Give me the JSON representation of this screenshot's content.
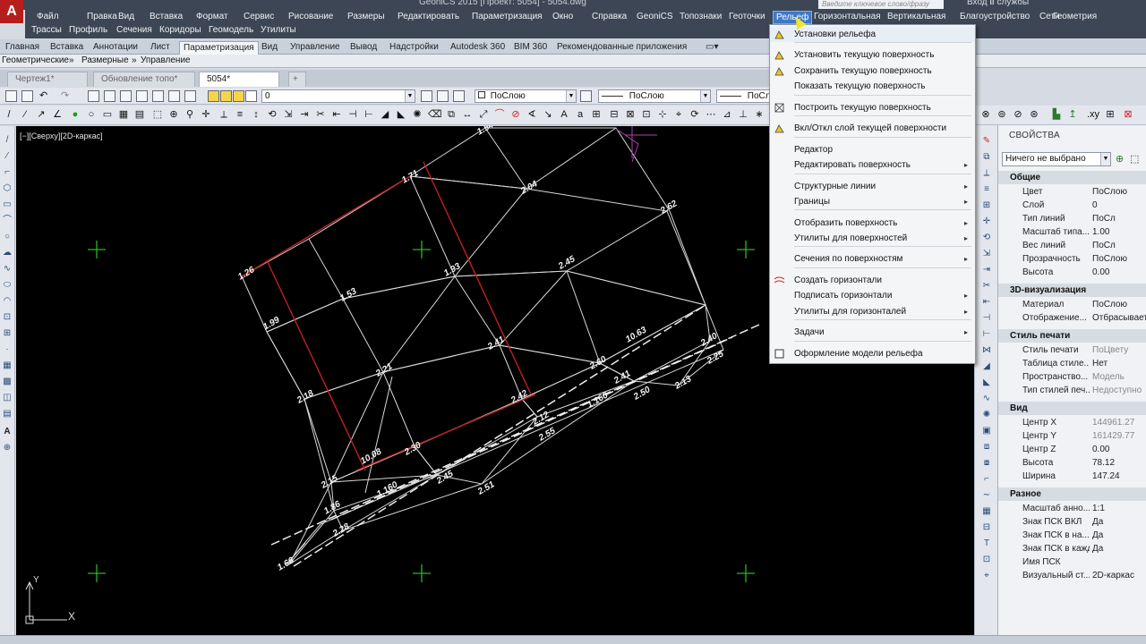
{
  "titlebar": {
    "title": "GeoniCS 2015 [Проект: 5054] - 5054.dwg",
    "search_placeholder": "Введите ключевое слово/фразу",
    "login": "Вход в службы"
  },
  "app_button": {
    "label": "A"
  },
  "menu": [
    "Файл",
    "Правка",
    "Вид",
    "Вставка",
    "Формат",
    "Сервис",
    "Рисование",
    "Размеры",
    "Редактировать",
    "Параметризация",
    "Окно",
    "Справка",
    "GeoniCS",
    "Топознаки",
    "Геоточки",
    "Рельеф",
    "Горизонтальная",
    "Вертикальная",
    "Благоустройство",
    "Сети",
    "Геометрия"
  ],
  "menu_active": "Рельеф",
  "menu2": [
    "Трассы",
    "Профиль",
    "Сечения",
    "Коридоры",
    "Геомодель",
    "Утилиты"
  ],
  "ribbon_tabs": [
    "Главная",
    "Вставка",
    "Аннотации",
    "Лист",
    "Параметризация",
    "Вид",
    "Управление",
    "Вывод",
    "Надстройки",
    "Autodesk 360",
    "BIM 360",
    "Рекомендованные приложения"
  ],
  "ribbon_active": "Параметризация",
  "ribbon_panels": [
    "Геометрические",
    "Размерные",
    "Управление"
  ],
  "doc_tabs": [
    {
      "label": "Чертеж1*",
      "active": false
    },
    {
      "label": "Обновление топо*",
      "active": false
    },
    {
      "label": "5054*",
      "active": true
    }
  ],
  "layer_combo": "0",
  "color_combo": "ПоСлою",
  "linetype_combo": "ПоСлою",
  "lineweight_combo": "ПоСло",
  "viewport_label": "[−][Сверху][2D-каркас]",
  "context_menu": {
    "items": [
      {
        "label": "Установки рельефа",
        "sub": false,
        "hi": true
      },
      {
        "label": "Установить текущую поверхность",
        "sub": false
      },
      {
        "label": "Сохранить текущую поверхность",
        "sub": false
      },
      {
        "label": "Показать текущую поверхность",
        "sub": false
      },
      {
        "label": "Построить текущую поверхность",
        "sub": false
      },
      {
        "label": "Вкл/Откл слой текущей поверхности",
        "sub": false
      },
      {
        "label": "Редактор",
        "sub": false
      },
      {
        "label": "Редактировать поверхность",
        "sub": true
      },
      {
        "label": "Структурные линии",
        "sub": true
      },
      {
        "label": "Границы",
        "sub": true
      },
      {
        "label": "Отобразить поверхность",
        "sub": true
      },
      {
        "label": "Утилиты для поверхностей",
        "sub": true
      },
      {
        "label": "Сечения по поверхностям",
        "sub": true
      },
      {
        "label": "Создать горизонтали",
        "sub": false
      },
      {
        "label": "Подписать горизонтали",
        "sub": true
      },
      {
        "label": "Утилиты для горизонталей",
        "sub": true
      },
      {
        "label": "Задачи",
        "sub": true
      },
      {
        "label": "Оформление модели рельефа",
        "sub": false
      }
    ],
    "arrow": "▸"
  },
  "properties": {
    "title": "СВОЙСТВА",
    "selection": "Ничего не выбрано",
    "sections": [
      {
        "name": "Общие",
        "rows": [
          [
            "Цвет",
            "ПоСлою"
          ],
          [
            "Слой",
            "0"
          ],
          [
            "Тип линий",
            "ПоСл"
          ],
          [
            "Масштаб типа...",
            "1.00"
          ],
          [
            "Вес линий",
            "ПоСл"
          ],
          [
            "Прозрачность",
            "ПоСлою"
          ],
          [
            "Высота",
            "0.00"
          ]
        ]
      },
      {
        "name": "3D-визуализация",
        "rows": [
          [
            "Материал",
            "ПоСлою"
          ],
          [
            "Отображение...",
            "Отбрасывает"
          ]
        ]
      },
      {
        "name": "Стиль печати",
        "rows": [
          [
            "Стиль печати",
            "ПоЦвету"
          ],
          [
            "Таблица стиле...",
            "Нет"
          ],
          [
            "Пространство...",
            "Модель"
          ],
          [
            "Тип стилей печ...",
            "Недоступно"
          ]
        ]
      },
      {
        "name": "Вид",
        "rows": [
          [
            "Центр X",
            "144961.27"
          ],
          [
            "Центр Y",
            "161429.77"
          ],
          [
            "Центр Z",
            "0.00"
          ],
          [
            "Высота",
            "78.12"
          ],
          [
            "Ширина",
            "147.24"
          ]
        ]
      },
      {
        "name": "Разное",
        "rows": [
          [
            "Масштаб анно...",
            "1:1"
          ],
          [
            "Знак ПСК ВКЛ",
            "Да"
          ],
          [
            "Знак ПСК в на...",
            "Да"
          ],
          [
            "Знак ПСК в кажд...",
            "Да"
          ],
          [
            "Имя ПСК",
            ""
          ],
          [
            "Визуальный ст...",
            "2D-каркас"
          ]
        ]
      }
    ]
  },
  "drawing": {
    "labels": [
      "1.54",
      "2.62",
      "2.04",
      "1.71",
      "1.93",
      "1.53",
      "2.45",
      "1.26",
      "1.99",
      "2.21",
      "2.41",
      "2.18",
      "10.08",
      "2.30",
      "2.42",
      "2.60",
      "10.63",
      "2.40",
      "2.41",
      "2.50",
      "2.13",
      "2.45",
      "2.51",
      "2.12",
      "2.25",
      "2.55",
      "2.15",
      "2.28",
      "1.66",
      "1.160",
      "1.160",
      "1.86"
    ],
    "ucs_y": "Y",
    "ucs_x": "X"
  }
}
